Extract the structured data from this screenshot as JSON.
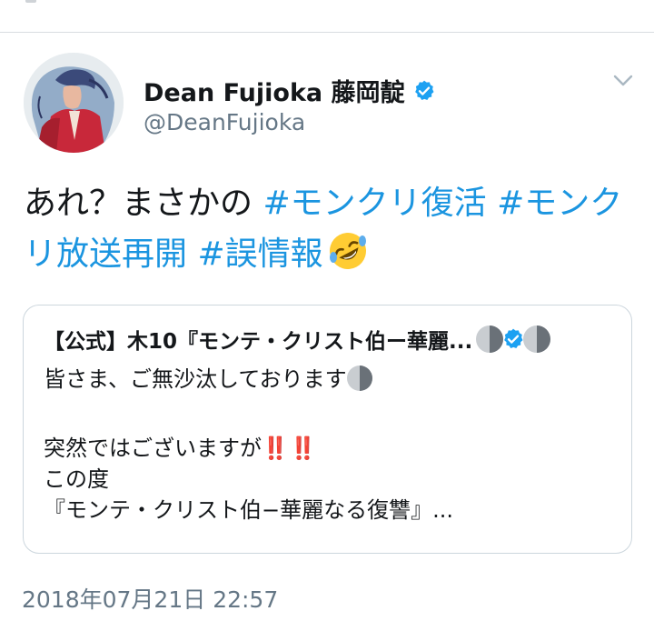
{
  "tweet": {
    "display_name": "Dean Fujioka 藤岡靛",
    "handle": "@DeanFujioka",
    "text_parts": [
      "あれ？まさかの ",
      "#モンクリ復活",
      " ",
      "#モンクリ放送再開",
      " ",
      "#誤情報"
    ],
    "timestamp": "2018年07月21日 22:57"
  },
  "quoted": {
    "name": "【公式】木10『モンテ・クリスト伯ー華麗...",
    "lines": [
      "皆さま、ご無沙汰しております",
      "突然ではございますが",
      "この度",
      "『モンテ・クリスト伯−華麗なる復讐』..."
    ],
    "bangs": "‼️‼️"
  },
  "icons": {
    "verified": "verified-badge-icon",
    "caret": "chevron-down-icon",
    "emoji": "rofl-emoji",
    "moon": "waning-moon-emoji"
  },
  "colors": {
    "hashtag": "#1b95e0",
    "secondary_text": "#657786",
    "verified": "#1da1f2",
    "border": "#ccd6dd"
  }
}
